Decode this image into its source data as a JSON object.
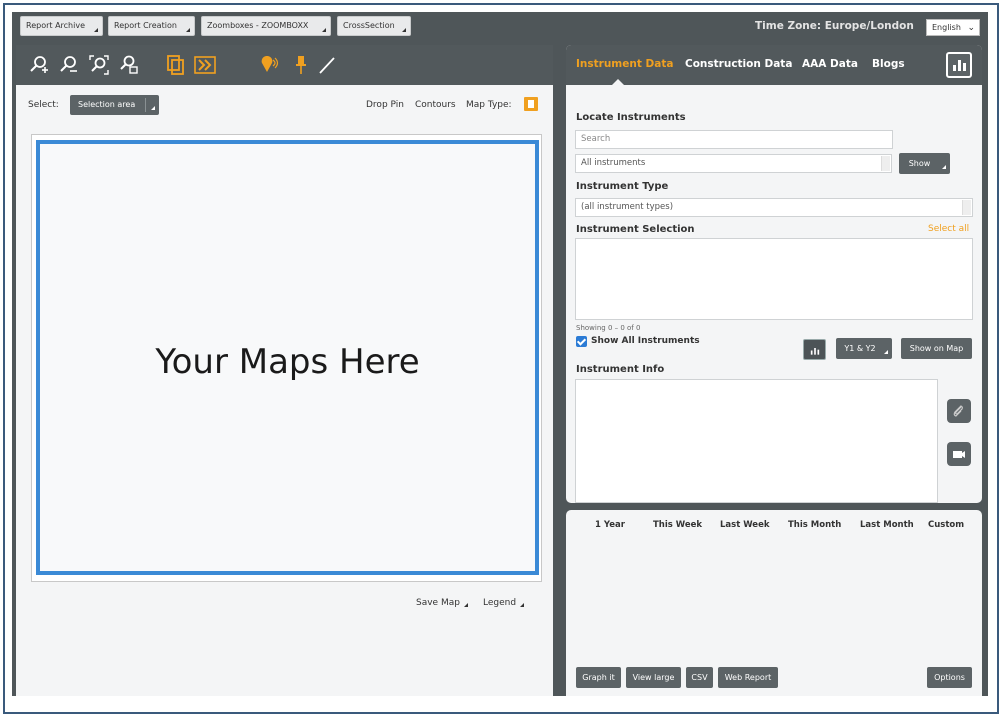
{
  "topbar": {
    "buttons": [
      "Report Archive",
      "Report Creation",
      "Zoomboxes - ZOOMBOXX",
      "CrossSection"
    ],
    "timezone": "Time Zone: Europe/London",
    "language": "English"
  },
  "map_toolbar": {
    "tools": [
      "zoom-in-icon",
      "zoom-out-icon",
      "zoom-extent-icon",
      "zoom-select-icon",
      "copy-icon",
      "forward-icon",
      "pin-drop-icon",
      "pin-icon",
      "line-icon"
    ]
  },
  "map": {
    "select_label": "Select:",
    "select_value": "Selection area",
    "drop_pin": "Drop Pin",
    "contours": "Contours",
    "map_type": "Map Type:",
    "placeholder": "Your Maps Here",
    "save_map": "Save Map",
    "legend": "Legend"
  },
  "tabs": [
    "Instrument Data",
    "Construction Data",
    "AAA Data",
    "Blogs"
  ],
  "instrument_panel": {
    "locate_title": "Locate Instruments",
    "search_placeholder": "Search",
    "all_instruments": "All instruments",
    "show_btn": "Show",
    "type_title": "Instrument Type",
    "type_value": "(all instrument types)",
    "selection_title": "Instrument Selection",
    "select_all": "Select all",
    "showing": "Showing 0 – 0 of 0",
    "show_all_label": "Show All Instruments",
    "y_axis_btn": "Y1 & Y2",
    "show_on_map_btn": "Show on Map",
    "info_title": "Instrument Info"
  },
  "ranges": [
    "1 Year",
    "This Week",
    "Last Week",
    "This Month",
    "Last Month",
    "Custom"
  ],
  "bottom_buttons": {
    "graph_it": "Graph it",
    "view_large": "View large",
    "csv": "CSV",
    "web_report": "Web Report",
    "options": "Options"
  },
  "colors": {
    "accent": "#f0a020",
    "panel_dark": "#4f5659",
    "map_border": "#3b8ad6"
  }
}
